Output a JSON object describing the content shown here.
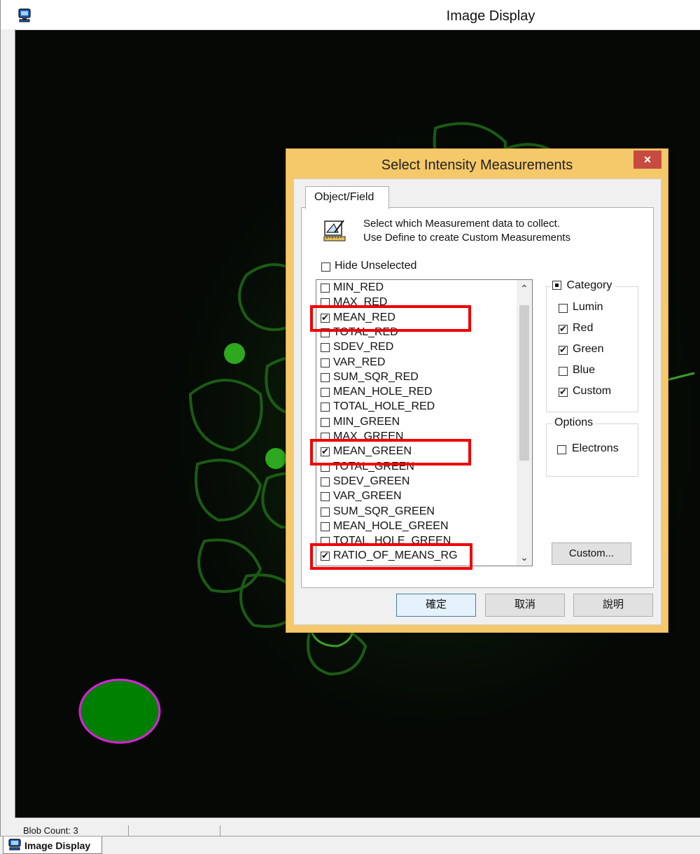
{
  "window": {
    "title": "Image Display"
  },
  "status": {
    "blob_count": "Blob Count: 3"
  },
  "taskbar": {
    "tab_label": "Image Display"
  },
  "dialog": {
    "title": "Select Intensity Measurements",
    "close_glyph": "×",
    "tab_label": "Object/Field",
    "header_line1": "Select which Measurement data to collect.",
    "header_line2": "Use Define to create Custom Measurements",
    "hide_unselected": {
      "label": "Hide Unselected",
      "checked": false
    },
    "measurements": [
      {
        "label": "MIN_RED",
        "checked": false
      },
      {
        "label": "MAX_RED",
        "checked": false
      },
      {
        "label": "MEAN_RED",
        "checked": true,
        "highlighted": true
      },
      {
        "label": "TOTAL_RED",
        "checked": false
      },
      {
        "label": "SDEV_RED",
        "checked": false
      },
      {
        "label": "VAR_RED",
        "checked": false
      },
      {
        "label": "SUM_SQR_RED",
        "checked": false
      },
      {
        "label": "MEAN_HOLE_RED",
        "checked": false
      },
      {
        "label": "TOTAL_HOLE_RED",
        "checked": false
      },
      {
        "label": "MIN_GREEN",
        "checked": false
      },
      {
        "label": "MAX_GREEN",
        "checked": false
      },
      {
        "label": "MEAN_GREEN",
        "checked": true,
        "highlighted": true
      },
      {
        "label": "TOTAL_GREEN",
        "checked": false
      },
      {
        "label": "SDEV_GREEN",
        "checked": false
      },
      {
        "label": "VAR_GREEN",
        "checked": false
      },
      {
        "label": "SUM_SQR_GREEN",
        "checked": false
      },
      {
        "label": "MEAN_HOLE_GREEN",
        "checked": false
      },
      {
        "label": "TOTAL_HOLE_GREEN",
        "checked": false
      },
      {
        "label": "RATIO_OF_MEANS_RG",
        "checked": true,
        "highlighted": true
      }
    ],
    "category": {
      "caption": "Category",
      "items": [
        {
          "label": "Lumin",
          "checked": false
        },
        {
          "label": "Red",
          "checked": true
        },
        {
          "label": "Green",
          "checked": true
        },
        {
          "label": "Blue",
          "checked": false
        },
        {
          "label": "Custom",
          "checked": true
        }
      ]
    },
    "options": {
      "caption": "Options",
      "items": [
        {
          "label": "Electrons",
          "checked": false
        }
      ]
    },
    "custom_button": "Custom...",
    "ok_button": "確定",
    "cancel_button": "取消",
    "help_button": "說明"
  },
  "colors": {
    "dialog_frame": "#f5c86a",
    "highlight": "#f00000",
    "blob_fill": "#008000",
    "blob_outline": "#e01ee0",
    "close_button": "#c74b40"
  }
}
